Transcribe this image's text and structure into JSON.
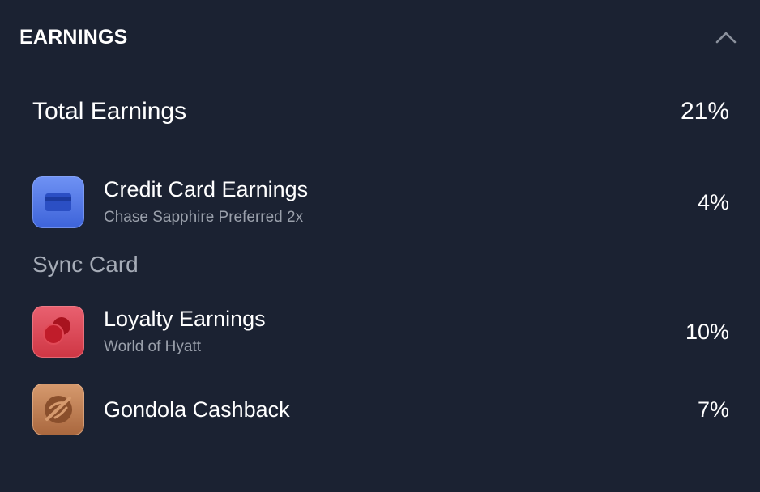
{
  "header": {
    "title": "EARNINGS"
  },
  "total": {
    "label": "Total Earnings",
    "value": "21%"
  },
  "credit_card": {
    "title": "Credit Card Earnings",
    "subtitle": "Chase Sapphire Preferred 2x",
    "value": "4%",
    "icon": "credit-card-icon",
    "color": "#4f76e6"
  },
  "section": {
    "label": "Sync Card"
  },
  "loyalty": {
    "title": "Loyalty Earnings",
    "subtitle": "World of Hyatt",
    "value": "10%",
    "icon": "hyatt-logo-icon",
    "color": "#d9404e"
  },
  "gondola": {
    "title": "Gondola Cashback",
    "value": "7%",
    "icon": "gondola-logo-icon",
    "color": "#b9784c"
  },
  "colors": {
    "background": "#1b2232",
    "text": "#ffffff",
    "muted": "#9aa0ab"
  }
}
